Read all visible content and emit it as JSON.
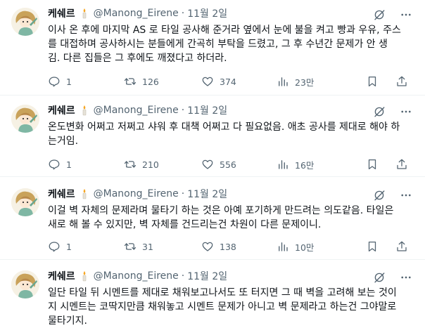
{
  "tweets": [
    {
      "author": "케쉐르",
      "handle": "@Manong_Eirene",
      "date": "11월 2일",
      "lines": [
        "이사 온 후에 마지막 AS 로 타일 공사해 준거라 옆에서 눈에 불을 켜고 빵과 우유, 주스",
        "를 대접하며 공사하시는 분들에게 간곡히 부탁을 드렸고, 그 후 수년간 문제가 안 생",
        "김. 다른 집들은 그 후에도 깨졌다고 하더라."
      ],
      "replies": "1",
      "retweets": "126",
      "likes": "374",
      "views": "23만"
    },
    {
      "author": "케쉐르",
      "handle": "@Manong_Eirene",
      "date": "11월 2일",
      "lines": [
        "온도변화 어쩌고 저쩌고 샤워 후 대책 어쩌고 다 필요없음. 애초 공사를 제대로 해야 하",
        "는거임."
      ],
      "replies": "1",
      "retweets": "210",
      "likes": "556",
      "views": "16만"
    },
    {
      "author": "케쉐르",
      "handle": "@Manong_Eirene",
      "date": "11월 2일",
      "lines": [
        "이걸 벽 자체의 문제라며 물타기 하는 것은 아예 포기하게 만드려는 의도같음. 타일은",
        "새로 해 볼 수 있지만, 벽 자체를 건드리는건 차원이 다른 문제이니."
      ],
      "replies": "1",
      "retweets": "31",
      "likes": "138",
      "views": "10만"
    },
    {
      "author": "케쉐르",
      "handle": "@Manong_Eirene",
      "date": "11월 2일",
      "lines": [
        "일단 타일 뒤 시멘트를 제대로 채워보고나서도 또 터지면 그 때 벽을 고려해 보는 것이",
        "지 시멘트는 코딱지만큼 채워놓고 시멘트 문제가 아니고 벽 문제라고 하는건 그야말로",
        "물타기지."
      ]
    }
  ],
  "colors": {
    "text": "#0f1419",
    "muted": "#536471",
    "divider": "#eff3f4"
  },
  "icons": [
    "avatar-illustration",
    "candle-emoji",
    "grok-icon",
    "more-icon",
    "reply-icon",
    "retweet-icon",
    "like-icon",
    "views-icon",
    "bookmark-icon",
    "share-icon"
  ]
}
